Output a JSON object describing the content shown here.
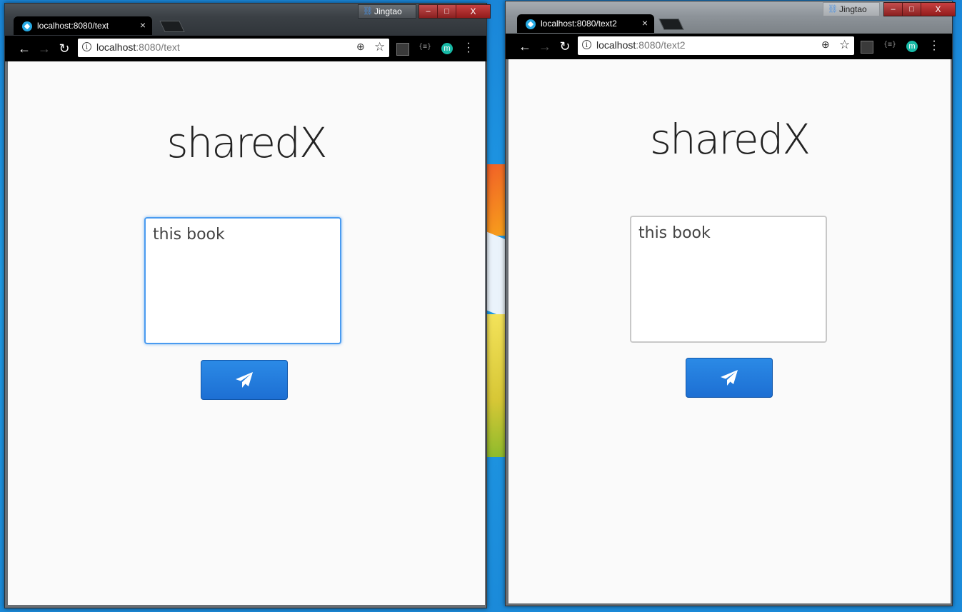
{
  "windows": [
    {
      "tab": {
        "title": "localhost:8080/text",
        "close": "×"
      },
      "profile": {
        "name": "Jingtao",
        "icon": "profile-icon"
      },
      "controls": {
        "minimize": "–",
        "maximize": "□",
        "close": "X"
      },
      "toolbar": {
        "back": "←",
        "forward": "→",
        "reload": "↻"
      },
      "omnibox": {
        "info": "i",
        "host": "localhost",
        "path": ":8080/text",
        "zoom": "⊕",
        "star": "☆"
      },
      "extensions": {
        "json": "{≡}",
        "m": "m"
      },
      "page": {
        "title": "sharedX",
        "text_value": "this book",
        "text_focused": true,
        "send_icon": "paper-plane-icon"
      }
    },
    {
      "tab": {
        "title": "localhost:8080/text2",
        "close": "×"
      },
      "profile": {
        "name": "Jingtao",
        "icon": "profile-icon"
      },
      "controls": {
        "minimize": "–",
        "maximize": "□",
        "close": "X"
      },
      "toolbar": {
        "back": "←",
        "forward": "→",
        "reload": "↻"
      },
      "omnibox": {
        "info": "i",
        "host": "localhost",
        "path": ":8080/text2",
        "zoom": "⊕",
        "star": "☆"
      },
      "extensions": {
        "json": "{≡}",
        "m": "m"
      },
      "page": {
        "title": "sharedX",
        "text_value": "this book",
        "text_focused": false,
        "send_icon": "paper-plane-icon"
      }
    }
  ]
}
